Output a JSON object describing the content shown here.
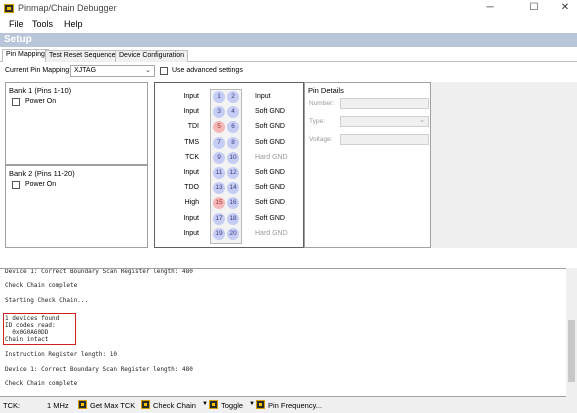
{
  "window": {
    "title": "Pinmap/Chain Debugger",
    "minimize": "─",
    "maximize": "☐",
    "close": "✕"
  },
  "menu": [
    "File",
    "Tools",
    "Help"
  ],
  "setup": {
    "title": "Setup"
  },
  "tabs": [
    "Pin Mapping",
    "Test Reset Sequence",
    "Device Configuration"
  ],
  "pin_mapping": {
    "label": "Current Pin Mapping:",
    "value": "XJTAG",
    "advanced_label": "Use advanced settings"
  },
  "banks": [
    {
      "title": "Bank 1 (Pins 1-10)",
      "power_label": "Power On"
    },
    {
      "title": "Bank 2 (Pins 11-20)",
      "power_label": "Power On"
    }
  ],
  "pins": [
    {
      "left": "Input",
      "a": "1",
      "b": "2",
      "right": "Input",
      "a_red": false,
      "right_muted": false
    },
    {
      "left": "Input",
      "a": "3",
      "b": "4",
      "right": "Soft GND",
      "a_red": false,
      "right_muted": false
    },
    {
      "left": "TDI",
      "a": "5",
      "b": "6",
      "right": "Soft GND",
      "a_red": true,
      "right_muted": false
    },
    {
      "left": "TMS",
      "a": "7",
      "b": "8",
      "right": "Soft GND",
      "a_red": false,
      "right_muted": false
    },
    {
      "left": "TCK",
      "a": "9",
      "b": "10",
      "right": "Hard GND",
      "a_red": false,
      "right_muted": true
    },
    {
      "left": "Input",
      "a": "11",
      "b": "12",
      "right": "Soft GND",
      "a_red": false,
      "right_muted": false
    },
    {
      "left": "TDO",
      "a": "13",
      "b": "14",
      "right": "Soft GND",
      "a_red": false,
      "right_muted": false
    },
    {
      "left": "High",
      "a": "15",
      "b": "16",
      "right": "Soft GND",
      "a_red": true,
      "right_muted": false
    },
    {
      "left": "Input",
      "a": "17",
      "b": "18",
      "right": "Soft GND",
      "a_red": false,
      "right_muted": false
    },
    {
      "left": "Input",
      "a": "19",
      "b": "20",
      "right": "Hard GND",
      "a_red": false,
      "right_muted": true
    }
  ],
  "details": {
    "title": "Pin Details",
    "number_label": "Number:",
    "type_label": "Type:",
    "voltage_label": "Voltage:"
  },
  "log": [
    "Device 1: Correct Boundary Scan Register length: 480",
    "Check Chain complete",
    "Starting Check Chain...",
    "1 devices found",
    "ID codes read:",
    "  0x0G0A60DD",
    "Chain intact",
    "Instruction Register length: 10",
    "Device 1: Correct Boundary Scan Register length: 480",
    "Check Chain complete"
  ],
  "status": {
    "tck_label": "TCK:",
    "tck_value": "1 MHz",
    "get_max": "Get Max TCK",
    "check_chain": "Check Chain",
    "toggle": "Toggle",
    "pin_freq": "Pin Frequency..."
  },
  "colors": {
    "setup_bar": "#b9c5d9",
    "pin_blue": "#c5cdf5",
    "pin_red": "#f4b8b8",
    "highlight": "#d02020"
  }
}
